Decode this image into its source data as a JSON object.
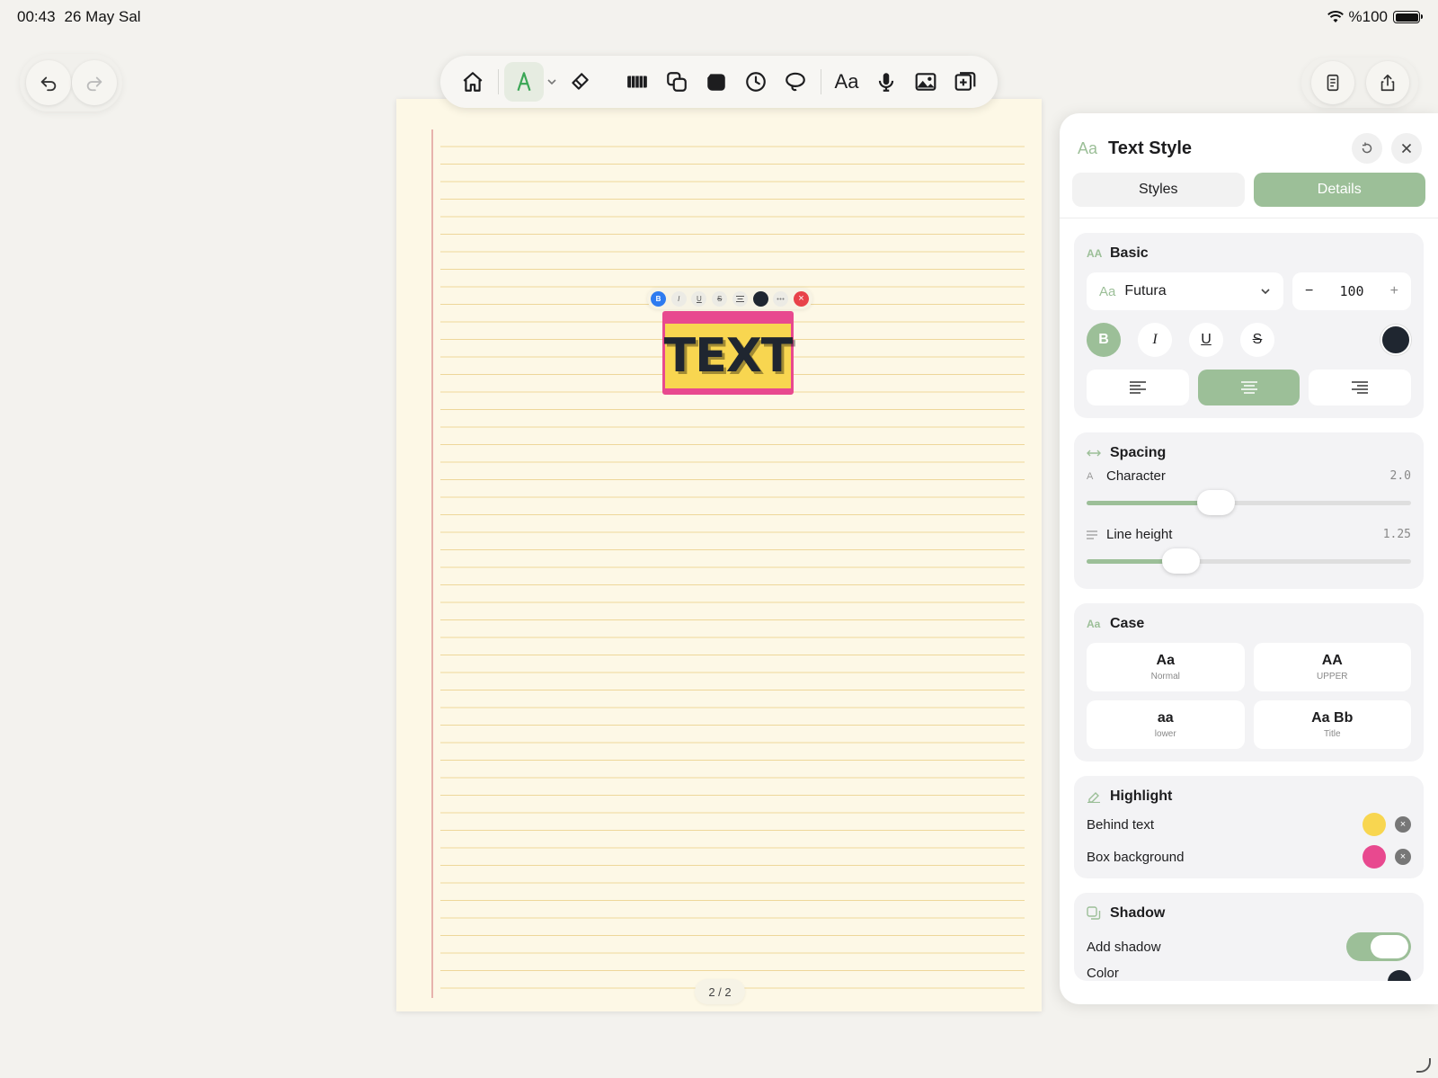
{
  "status": {
    "time": "00:43",
    "date": "26 May Sal",
    "battery": "%100",
    "battery_level": 1.0
  },
  "toolbar": {
    "tools": [
      "home-icon",
      "pen-icon",
      "eraser-icon",
      "marker-icon",
      "shapes-icon",
      "fill-icon",
      "history-icon",
      "lasso-icon",
      "text-tool",
      "mic-icon",
      "image-icon",
      "add-page-icon"
    ],
    "text_tool_label": "Aa",
    "active_tool": "pen-icon"
  },
  "page": {
    "page_indicator": "2 / 2",
    "text_box": {
      "content": "TEXT",
      "text_color": "#1f2630",
      "highlight_color": "#f8d650",
      "box_color": "#e8498f"
    },
    "mini_bar": {
      "bold": "B",
      "italic": "I",
      "underline": "U",
      "strike": "S",
      "close": "×"
    }
  },
  "panel": {
    "title_icon": "Aa",
    "title": "Text Style",
    "tabs": [
      {
        "label": "Styles",
        "active": false
      },
      {
        "label": "Details",
        "active": true
      }
    ],
    "basic": {
      "heading_icon": "AA",
      "heading": "Basic",
      "font_icon": "Aa",
      "font": "Futura",
      "size": "100",
      "minus": "−",
      "plus": "+",
      "bold": "B",
      "italic": "I",
      "underline": "U",
      "strike": "S",
      "color": "#1f2630",
      "alignment": "center"
    },
    "spacing": {
      "heading": "Spacing",
      "character_icon": "A",
      "character_label": "Character",
      "character_value": "2.0",
      "character_fraction": 0.4,
      "line_label": "Line height",
      "line_value": "1.25",
      "line_fraction": 0.29
    },
    "case": {
      "heading_icon": "Aa",
      "heading": "Case",
      "options": [
        {
          "big": "Aa",
          "small": "Normal"
        },
        {
          "big": "AA",
          "small": "UPPER"
        },
        {
          "big": "aa",
          "small": "lower"
        },
        {
          "big": "Aa Bb",
          "small": "Title"
        }
      ]
    },
    "highlight": {
      "heading": "Highlight",
      "behind_label": "Behind text",
      "behind_color": "#f8d650",
      "box_label": "Box background",
      "box_color": "#e8498f",
      "clear": "×"
    },
    "shadow": {
      "heading": "Shadow",
      "add_label": "Add shadow",
      "add_on": true,
      "color_label": "Color"
    }
  }
}
